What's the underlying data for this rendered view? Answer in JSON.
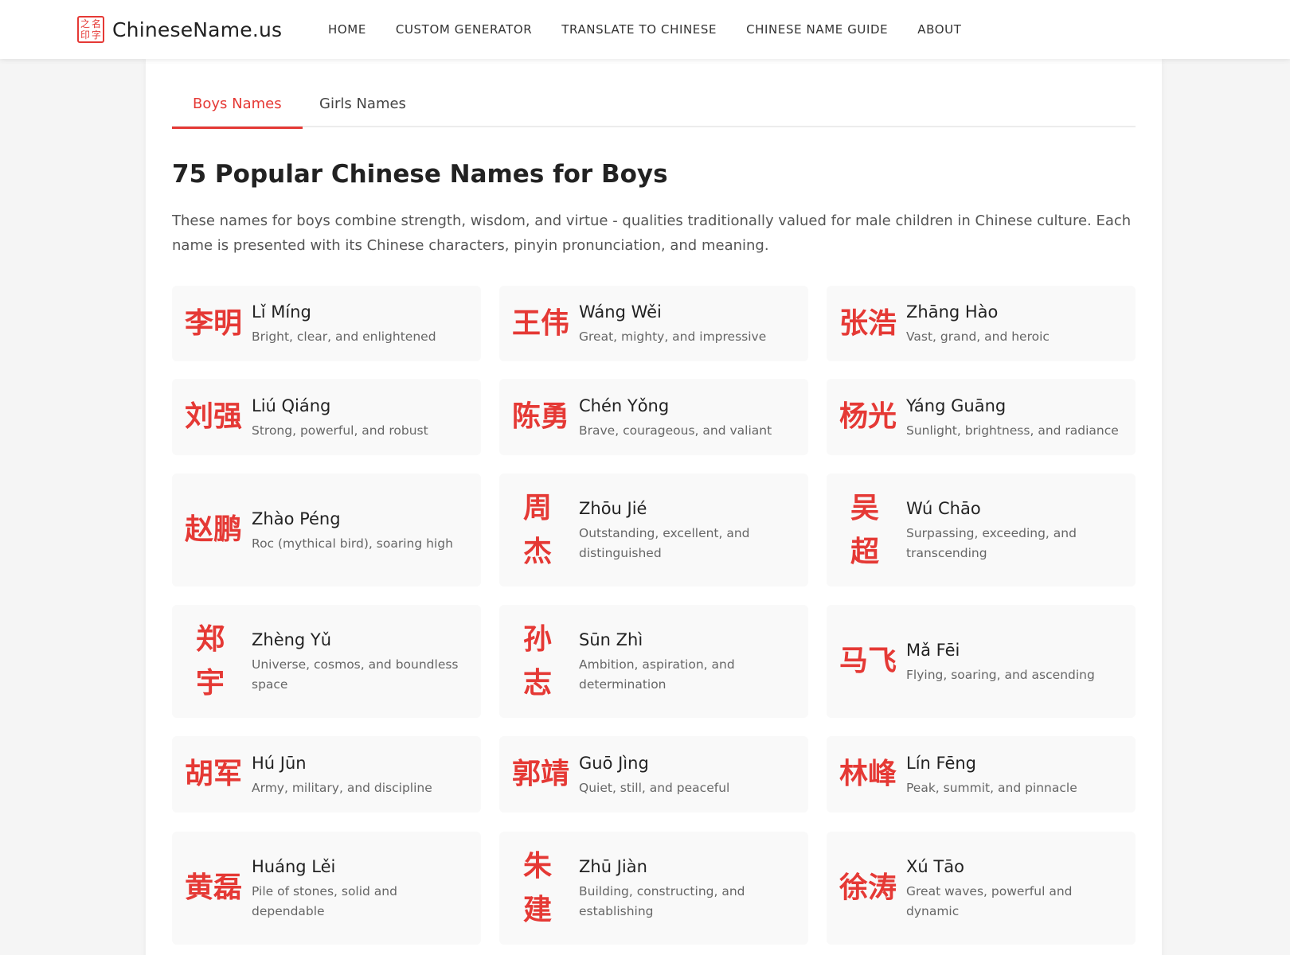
{
  "header": {
    "logo_seal": [
      "之",
      "名",
      "印",
      "字"
    ],
    "logo_text": "ChineseName.us",
    "nav": [
      "HOME",
      "CUSTOM GENERATOR",
      "TRANSLATE TO CHINESE",
      "CHINESE NAME GUIDE",
      "ABOUT"
    ]
  },
  "tabs": [
    "Boys Names",
    "Girls Names"
  ],
  "title": "75 Popular Chinese Names for Boys",
  "intro": "These names for boys combine strength, wisdom, and virtue - qualities traditionally valued for male children in Chinese culture. Each name is presented with its Chinese characters, pinyin pronunciation, and meaning.",
  "names": [
    {
      "hanzi": "李明",
      "pinyin": "Lǐ Míng",
      "meaning": "Bright, clear, and enlightened"
    },
    {
      "hanzi": "王伟",
      "pinyin": "Wáng Wěi",
      "meaning": "Great, mighty, and impressive"
    },
    {
      "hanzi": "张浩",
      "pinyin": "Zhāng Hào",
      "meaning": "Vast, grand, and heroic"
    },
    {
      "hanzi": "刘强",
      "pinyin": "Liú Qiáng",
      "meaning": "Strong, powerful, and robust"
    },
    {
      "hanzi": "陈勇",
      "pinyin": "Chén Yǒng",
      "meaning": "Brave, courageous, and valiant"
    },
    {
      "hanzi": "杨光",
      "pinyin": "Yáng Guāng",
      "meaning": "Sunlight, brightness, and radiance"
    },
    {
      "hanzi": "赵鹏",
      "pinyin": "Zhào Péng",
      "meaning": "Roc (mythical bird), soaring high"
    },
    {
      "hanzi": "周杰",
      "pinyin": "Zhōu Jié",
      "meaning": "Outstanding, excellent, and distinguished"
    },
    {
      "hanzi": "吴超",
      "pinyin": "Wú Chāo",
      "meaning": "Surpassing, exceeding, and transcending"
    },
    {
      "hanzi": "郑宇",
      "pinyin": "Zhèng Yǔ",
      "meaning": "Universe, cosmos, and boundless space"
    },
    {
      "hanzi": "孙志",
      "pinyin": "Sūn Zhì",
      "meaning": "Ambition, aspiration, and determination"
    },
    {
      "hanzi": "马飞",
      "pinyin": "Mǎ Fēi",
      "meaning": "Flying, soaring, and ascending"
    },
    {
      "hanzi": "胡军",
      "pinyin": "Hú Jūn",
      "meaning": "Army, military, and discipline"
    },
    {
      "hanzi": "郭靖",
      "pinyin": "Guō Jìng",
      "meaning": "Quiet, still, and peaceful"
    },
    {
      "hanzi": "林峰",
      "pinyin": "Lín Fēng",
      "meaning": "Peak, summit, and pinnacle"
    },
    {
      "hanzi": "黄磊",
      "pinyin": "Huáng Lěi",
      "meaning": "Pile of stones, solid and dependable"
    },
    {
      "hanzi": "朱建",
      "pinyin": "Zhū Jiàn",
      "meaning": "Building, constructing, and establishing"
    },
    {
      "hanzi": "徐涛",
      "pinyin": "Xú Tāo",
      "meaning": "Great waves, powerful and dynamic"
    }
  ]
}
